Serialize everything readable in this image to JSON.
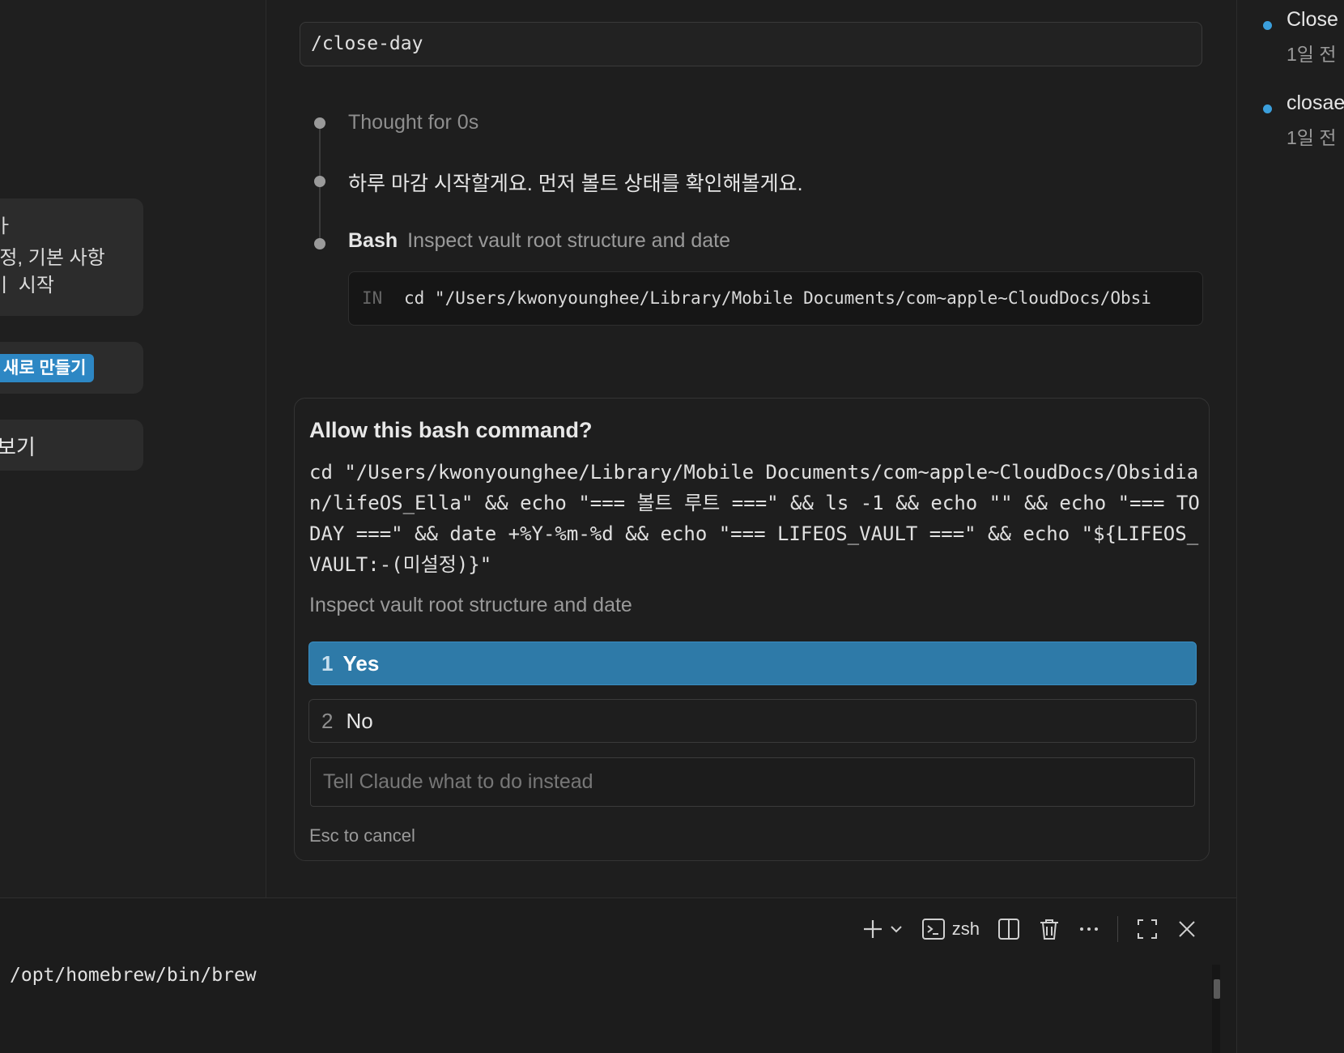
{
  "left_panel": {
    "info_card": {
      "line1": "ㅏ",
      "line2": "l정, 기본 사항",
      "line3": "ㅣ 시작"
    },
    "new_button_label": "새로 만들기",
    "view_label": "보기"
  },
  "chat": {
    "command": "/close-day",
    "thought": "Thought for 0s",
    "message": "하루 마감 시작할게요. 먼저 볼트 상태를 확인해볼게요.",
    "tool": {
      "name": "Bash",
      "description": "Inspect vault root structure and date",
      "in_label": "IN",
      "command_preview": "cd \"/Users/kwonyounghee/Library/Mobile Documents/com~apple~CloudDocs/Obsi"
    },
    "permission": {
      "title": "Allow this bash command?",
      "command": "cd \"/Users/kwonyounghee/Library/Mobile Documents/com~apple~CloudDocs/Obsidian/lifeOS_Ella\" && echo \"=== 볼트 루트 ===\" && ls -1 && echo \"\" && echo \"=== TODAY ===\" && date +%Y-%m-%d && echo \"=== LIFEOS_VAULT ===\" && echo \"${LIFEOS_VAULT:-(미설정)}\"",
      "description": "Inspect vault root structure and date",
      "options": [
        {
          "num": "1",
          "label": "Yes"
        },
        {
          "num": "2",
          "label": "No"
        }
      ],
      "instead_placeholder": "Tell Claude what to do instead",
      "esc_hint": "Esc to cancel"
    }
  },
  "right_panel": {
    "items": [
      {
        "title": "Close",
        "time": "1일 전"
      },
      {
        "title": "closae",
        "time": "1일 전"
      }
    ]
  },
  "terminal": {
    "shell": "zsh",
    "output": "/opt/homebrew/bin/brew",
    "icons": [
      "plus-icon",
      "chevron-down-icon",
      "terminal-icon",
      "split-icon",
      "trash-icon",
      "more-icon",
      "maximize-icon",
      "close-icon"
    ]
  },
  "colors": {
    "background": "#1e1e1e",
    "accent": "#2e7aa8",
    "badge": "#2d87c4",
    "dot": "#3b9fdc"
  }
}
